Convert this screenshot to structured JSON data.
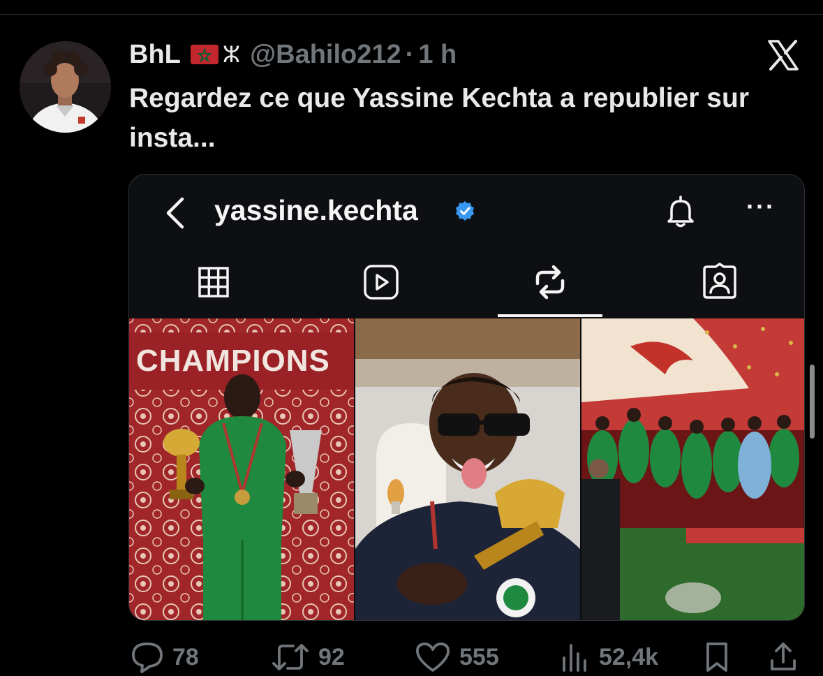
{
  "tweet": {
    "display_name": "BhL",
    "flag_icon": "morocco-flag-icon",
    "amazigh_glyph": "ⵣ",
    "handle": "@Bahilo212",
    "separator": "·",
    "time": "1 h",
    "text": "Regardez ce que Yassine Kechta a republier sur insta..."
  },
  "instagram": {
    "username": "yassine.kechta",
    "verified_icon": "verified-badge-icon",
    "tabs": [
      "grid-icon",
      "reels-icon",
      "reposts-icon",
      "tagged-icon"
    ],
    "active_tab": "reposts-icon",
    "more_label": "···",
    "images": [
      {
        "name": "champions-poster",
        "caption": "CHAMPIONS"
      },
      {
        "name": "player-with-trophy-selfie"
      },
      {
        "name": "team-celebration-photo"
      }
    ]
  },
  "actions": {
    "replies": "78",
    "reposts": "92",
    "likes": "555",
    "views": "52,4k"
  },
  "colors": {
    "background": "#000000",
    "text": "#e7e9ea",
    "muted": "#71767b",
    "ig_blue": "#3897f0"
  }
}
